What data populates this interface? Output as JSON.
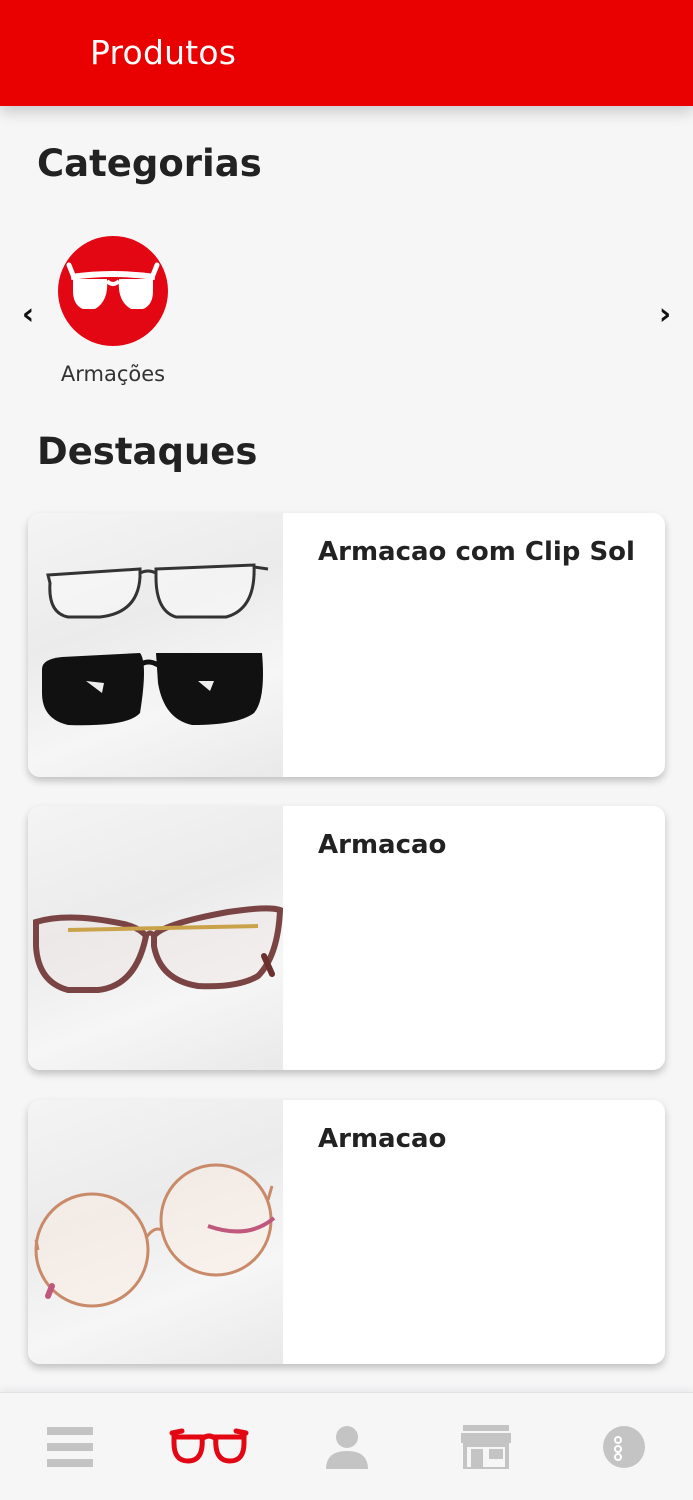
{
  "header": {
    "title": "Produtos",
    "color": "#e90000"
  },
  "categories": {
    "title": "Categorias",
    "prev_icon": "chevron-left-icon",
    "next_icon": "chevron-right-icon",
    "items": [
      {
        "label": "Armações",
        "icon": "glasses-icon",
        "color": "#e30613"
      }
    ]
  },
  "featured": {
    "title": "Destaques",
    "items": [
      {
        "title": "Armacao com Clip Sol",
        "image": "frame-with-sun-clip"
      },
      {
        "title": "Armacao",
        "image": "cat-eye-frame"
      },
      {
        "title": "Armacao",
        "image": "round-metal-frame"
      }
    ]
  },
  "bottom_nav": {
    "active_color": "#e30613",
    "inactive_color": "#c4c4c4",
    "items": [
      {
        "icon": "menu-icon",
        "active": false
      },
      {
        "icon": "glasses-icon",
        "active": true
      },
      {
        "icon": "user-icon",
        "active": false
      },
      {
        "icon": "store-icon",
        "active": false
      },
      {
        "icon": "info-icon",
        "active": false
      }
    ]
  }
}
